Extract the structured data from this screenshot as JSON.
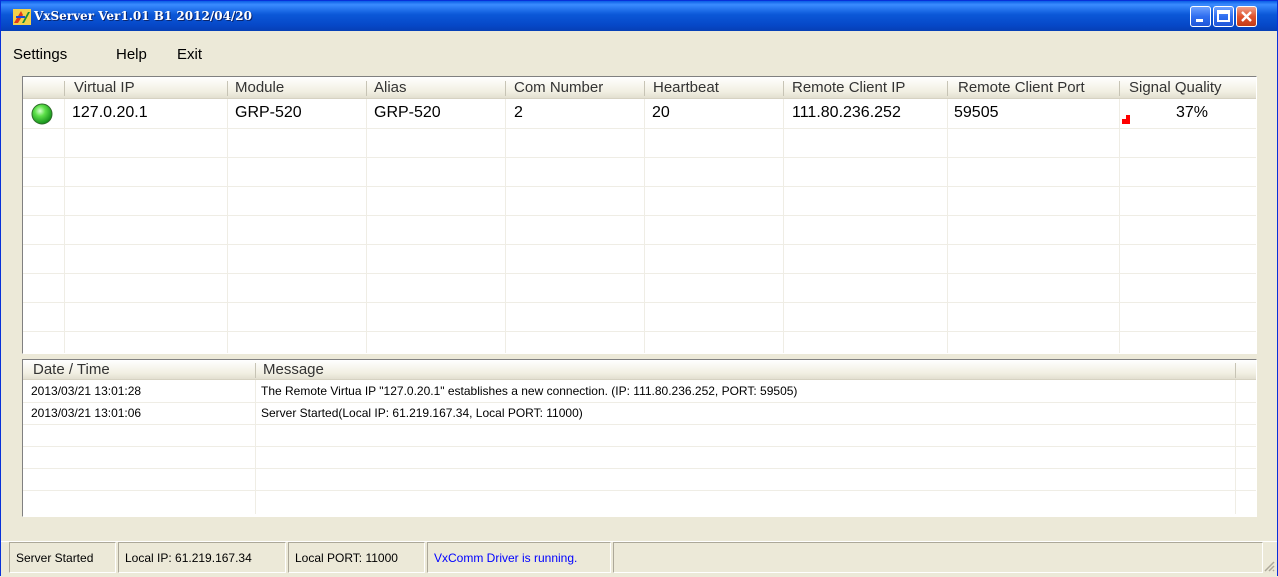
{
  "window": {
    "title": "VxServer Ver1.01 B1 2012/04/20",
    "title_color": "#0b58d8"
  },
  "menu": {
    "settings": "Settings",
    "help": "Help",
    "exit": "Exit"
  },
  "connections": {
    "columns": [
      "Virtual IP",
      "Module",
      "Alias",
      "Com Number",
      "Heartbeat",
      "Remote Client IP",
      "Remote Client Port",
      "Signal Quality"
    ],
    "rows": [
      {
        "status": "connected",
        "status_color": "#22c422",
        "virtual_ip": "127.0.20.1",
        "module": "GRP-520",
        "alias": "GRP-520",
        "com_number": "2",
        "heartbeat": "20",
        "remote_client_ip": "111.80.236.252",
        "remote_client_port": "59505",
        "signal_quality": "37%",
        "signal_quality_value": 37,
        "signal_color": "#ff0000"
      }
    ]
  },
  "log": {
    "columns": [
      "Date / Time",
      "Message"
    ],
    "rows": [
      {
        "datetime": "2013/03/21 13:01:28",
        "message": "The Remote Virtua IP \"127.0.20.1\" establishes a new connection. (IP: 111.80.236.252, PORT: 59505)"
      },
      {
        "datetime": "2013/03/21 13:01:06",
        "message": "Server Started(Local IP: 61.219.167.34, Local PORT: 11000)"
      }
    ]
  },
  "status": {
    "server": "Server Started",
    "local_ip": "Local IP: 61.219.167.34",
    "local_port": "Local PORT: 11000",
    "driver": "VxComm Driver is running.",
    "driver_color": "#0000ff"
  }
}
